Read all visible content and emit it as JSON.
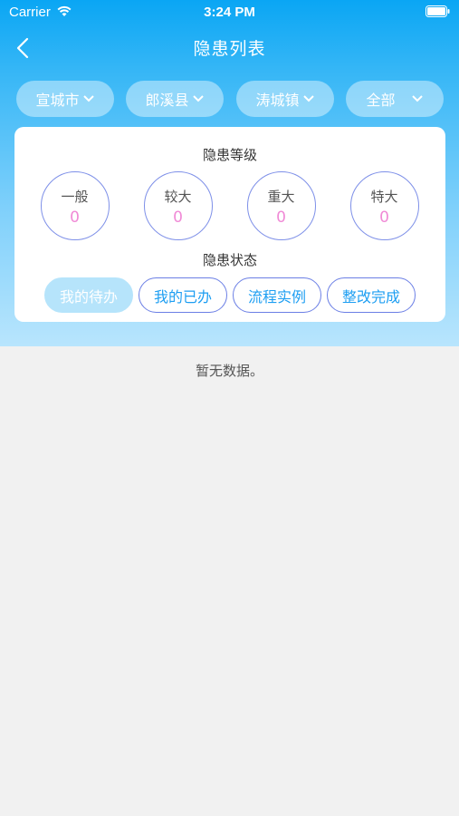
{
  "status_bar": {
    "carrier": "Carrier",
    "time": "3:24 PM"
  },
  "nav": {
    "title": "隐患列表",
    "back_icon": "chevron-left-icon"
  },
  "filters": [
    {
      "label": "宣城市"
    },
    {
      "label": "郎溪县"
    },
    {
      "label": "涛城镇"
    },
    {
      "label": "全部"
    }
  ],
  "levels": {
    "title": "隐患等级",
    "items": [
      {
        "name": "一般",
        "count": "0"
      },
      {
        "name": "较大",
        "count": "0"
      },
      {
        "name": "重大",
        "count": "0"
      },
      {
        "name": "特大",
        "count": "0"
      }
    ]
  },
  "status": {
    "title": "隐患状态",
    "buttons": [
      {
        "label": "我的待办",
        "active": true
      },
      {
        "label": "我的已办",
        "active": false
      },
      {
        "label": "流程实例",
        "active": false
      },
      {
        "label": "整改完成",
        "active": false
      }
    ]
  },
  "empty_text": "暂无数据。",
  "colors": {
    "header_top": "#0aa6f4",
    "header_bottom": "#b8e5fd",
    "accent": "#1d9ef2",
    "count": "#f08ad6",
    "circle_border": "#7d8fe8"
  }
}
